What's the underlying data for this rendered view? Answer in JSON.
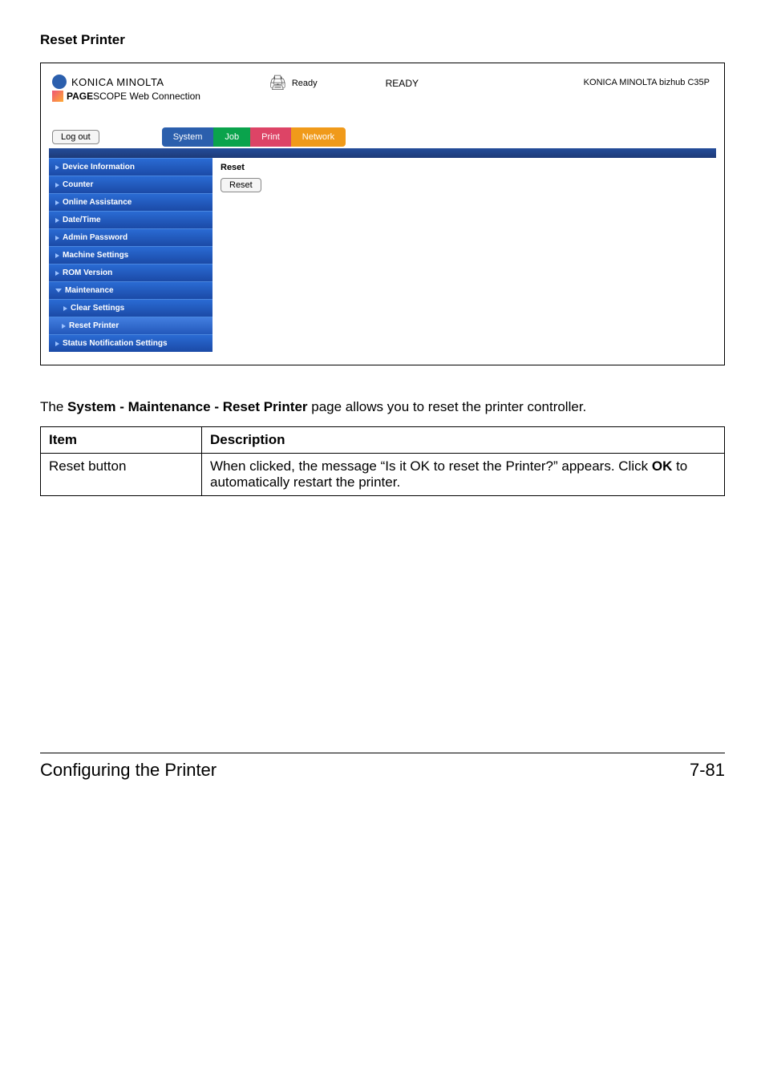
{
  "section_title": "Reset Printer",
  "header": {
    "brand": "KONICA MINOLTA",
    "product_prefix": "PAGE",
    "product_suffix": "SCOPE",
    "product_tail": " Web Connection",
    "status_label": "Ready",
    "ready_label": "READY",
    "model": "KONICA MINOLTA bizhub C35P"
  },
  "toolbar": {
    "logout_label": "Log out",
    "tabs": {
      "system": "System",
      "job": "Job",
      "print": "Print",
      "network": "Network"
    }
  },
  "menu": {
    "device_information": "Device Information",
    "counter": "Counter",
    "online_assistance": "Online Assistance",
    "date_time": "Date/Time",
    "admin_password": "Admin Password",
    "machine_settings": "Machine Settings",
    "rom_version": "ROM Version",
    "maintenance": "Maintenance",
    "clear_settings": "Clear Settings",
    "reset_printer": "Reset Printer",
    "status_notification_settings": "Status Notification Settings"
  },
  "panel": {
    "title": "Reset",
    "reset_button": "Reset"
  },
  "explain": {
    "prefix": "The ",
    "bold": "System - Maintenance - Reset Printer",
    "suffix": " page allows you to reset the printer controller."
  },
  "table": {
    "header_item": "Item",
    "header_description": "Description",
    "row1_item": "Reset button",
    "row1_desc_prefix": "When clicked, the message “Is it OK to reset the Printer?” appears. Click ",
    "row1_desc_bold": "OK",
    "row1_desc_suffix": " to automatically restart the printer."
  },
  "footer": {
    "left": "Configuring the Printer",
    "right": "7-81"
  }
}
